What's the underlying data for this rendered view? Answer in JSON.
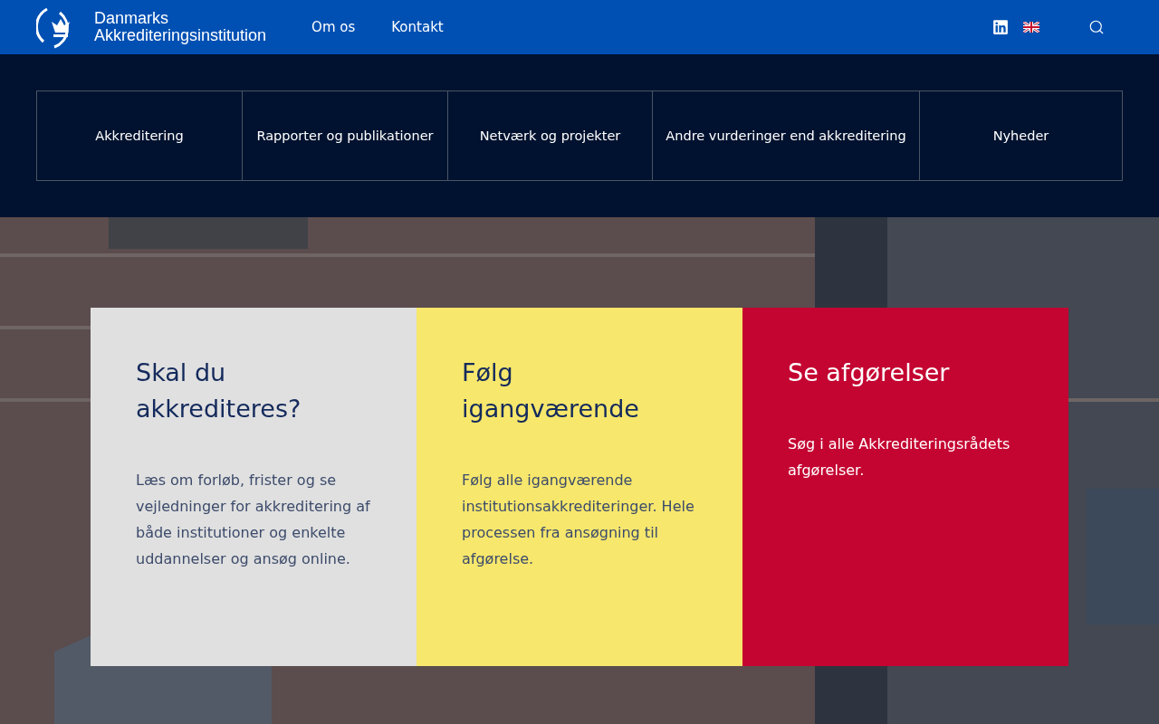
{
  "header": {
    "logo_text": [
      "Danmarks",
      "Akkrediteringsinstitution"
    ],
    "nav": [
      "Om os",
      "Kontakt"
    ]
  },
  "menu": [
    "Akkreditering",
    "Rapporter og publikationer",
    "Netværk og projekter",
    "Andre vurderinger end akkreditering",
    "Nyheder"
  ],
  "cards": [
    {
      "title": "Skal du akkrediteres?",
      "text": "Læs om forløb, frister og se vejledninger for akkreditering af både institutioner og enkelte uddannelser og ansøg online.",
      "color": "#e0e0e0"
    },
    {
      "title": "Følg igangværende",
      "text": "Følg alle igangværende institutionsakkrediteringer. Hele processen fra ansøgning til afgørelse.",
      "color": "#f7e76c"
    },
    {
      "title": "Se afgørelser",
      "text": "Søg i alle Akkrediteringsrådets afgørelser.",
      "color": "#c40431"
    }
  ]
}
